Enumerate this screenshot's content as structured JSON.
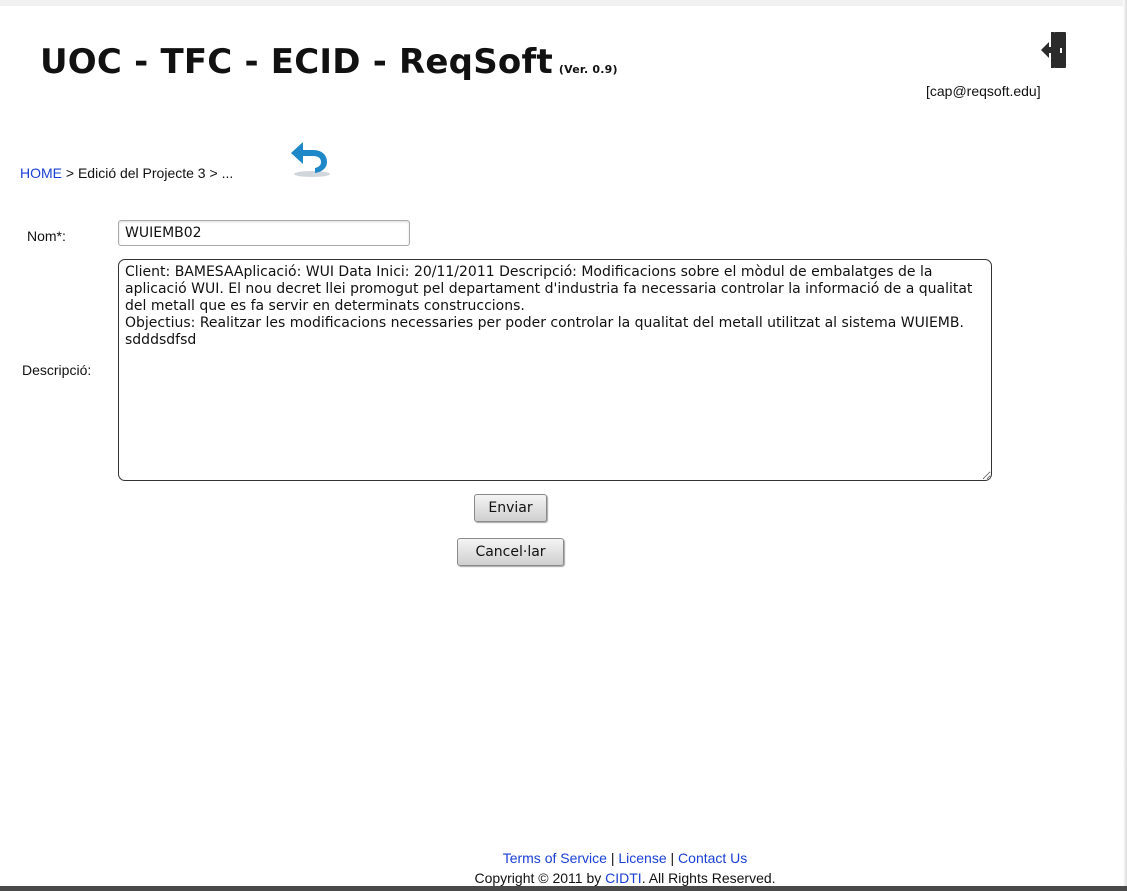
{
  "header": {
    "title": "UOC - TFC - ECID - ReqSoft",
    "version": "(Ver. 0.9)",
    "user_email": "[cap@reqsoft.edu]",
    "logout_icon": "logout-icon"
  },
  "breadcrumb": {
    "home": "HOME",
    "separator1": " > ",
    "current": "Edició del Projecte 3",
    "separator2": " > ",
    "ellipsis": "...",
    "back_icon": "back-arrow-icon"
  },
  "form": {
    "name_label": "Nom*:",
    "name_value": "WUIEMB02",
    "description_label": "Descripció:",
    "description_value": "Client: BAMESAAplicació: WUI Data Inici: 20/11/2011 Descripció: Modificacions sobre el mòdul de embalatges de la aplicació WUI. El nou decret llei promogut pel departament d'industria fa necessaria controlar la informació de a qualitat del metall que es fa servir en determinats construccions.\nObjectius: Realitzar les modificacions necessaries per poder controlar la qualitat del metall utilitzat al sistema WUIEMB.\nsdddsdfsd",
    "send_label": "Enviar",
    "cancel_label": "Cancel·lar"
  },
  "footer": {
    "terms": "Terms of Service",
    "sep1": " | ",
    "license": "License",
    "sep2": " | ",
    "contact": "Contact Us",
    "copyright_prefix": "Copyright © 2011 by ",
    "copyright_org": "CIDTI",
    "copyright_suffix": ". All Rights Reserved."
  },
  "colors": {
    "link": "#1a3fd6",
    "back_icon": "#1e88c8"
  }
}
